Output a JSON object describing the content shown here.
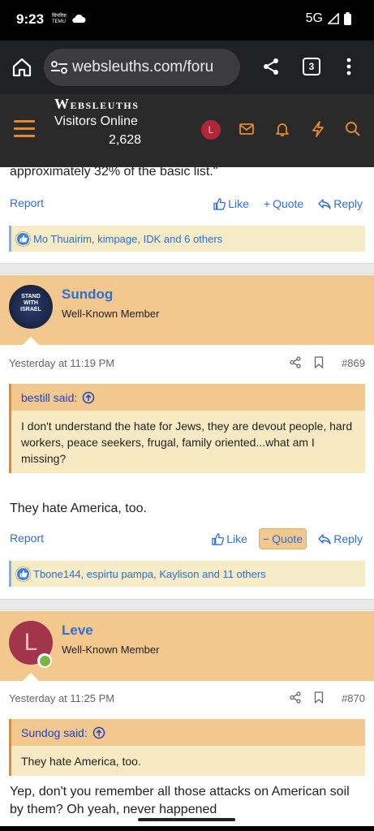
{
  "status": {
    "time": "9:23",
    "mini": [
      "सिमरिक",
      "TEMU"
    ],
    "network": "5G"
  },
  "browser": {
    "url": "websleuths.com/foru",
    "tab_count": "3"
  },
  "header": {
    "logo_big": "W",
    "logo_rest": "EBSLEUTHS",
    "visitors_label": "Visitors Online",
    "visitors_count": "2,628",
    "avatar_letter": "L"
  },
  "prev_post": {
    "quote_tail": "approximately 32% of the basic list.\"",
    "actions": {
      "report": "Report",
      "like": "Like",
      "quote": "Quote",
      "reply": "Reply"
    },
    "reactions": "Mo Thuairim, kimpage, IDK and 6 others"
  },
  "post1": {
    "username": "Sundog",
    "usertitle": "Well-Known Member",
    "avatar_text": [
      "STAND",
      "WITH",
      "ISRAEL"
    ],
    "time": "Yesterday at 11:19 PM",
    "number": "#869",
    "quote_author": "bestill said:",
    "quote_text": "I don't understand the hate for Jews, they are devout people, hard workers, peace seekers, frugal, family oriented...what am I missing?",
    "text": "They hate America, too.",
    "actions": {
      "report": "Report",
      "like": "Like",
      "quote": "Quote",
      "reply": "Reply"
    },
    "reactions": "Tbone144, espirtu pampa, Kaylison and 11 others"
  },
  "post2": {
    "username": "Leve",
    "usertitle": "Well-Known Member",
    "avatar_letter": "L",
    "time": "Yesterday at 11:25 PM",
    "number": "#870",
    "quote_author": "Sundog said:",
    "quote_text": "They hate America, too.",
    "text": "Yep, don't you remember all those attacks on American soil by them? Oh yeah, never happened"
  },
  "colors": {
    "accent": "#e58a2c",
    "link": "#2f6fd3",
    "postHead": "#f2c88e",
    "header": "#2a2a2a"
  }
}
